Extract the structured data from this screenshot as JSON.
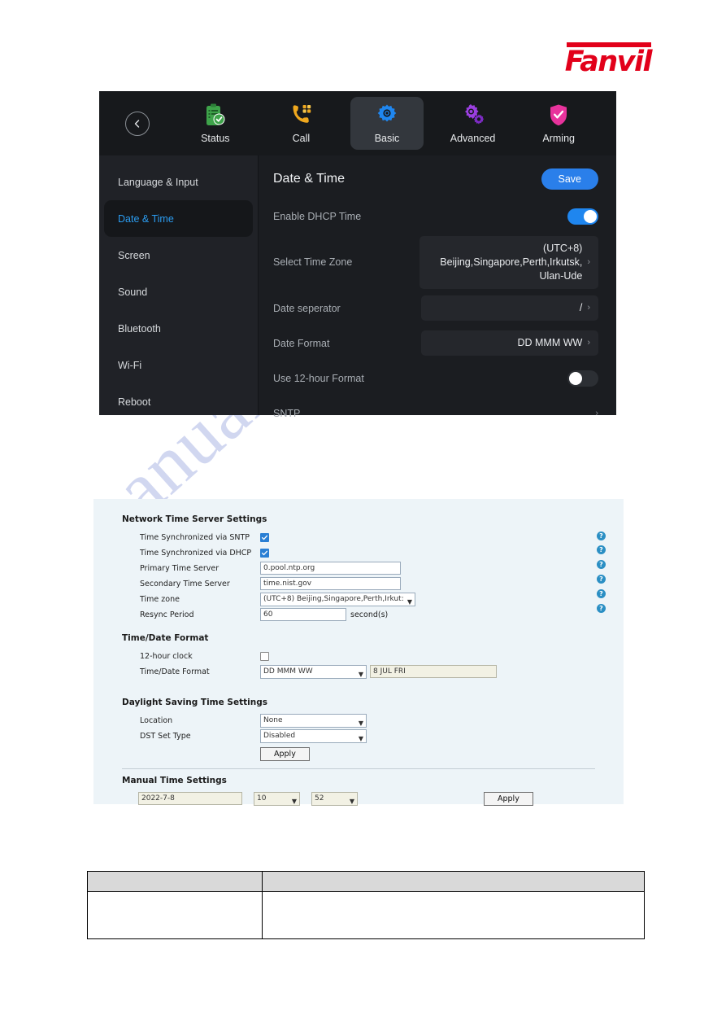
{
  "brand": {
    "name": "Fanvil",
    "color": "#e2001a"
  },
  "watermark": {
    "text": "manualshive.com"
  },
  "device": {
    "back_icon": "chevron-left-icon",
    "nav": [
      {
        "label": "Status",
        "icon": "clipboard-check-icon",
        "active": false
      },
      {
        "label": "Call",
        "icon": "phone-dialpad-icon",
        "active": false
      },
      {
        "label": "Basic",
        "icon": "gear-icon",
        "active": true
      },
      {
        "label": "Advanced",
        "icon": "double-gear-icon",
        "active": false
      },
      {
        "label": "Arming",
        "icon": "shield-check-icon",
        "active": false
      }
    ],
    "sidebar": [
      {
        "label": "Language & Input",
        "active": false
      },
      {
        "label": "Date & Time",
        "active": true
      },
      {
        "label": "Screen",
        "active": false
      },
      {
        "label": "Sound",
        "active": false
      },
      {
        "label": "Bluetooth",
        "active": false
      },
      {
        "label": "Wi-Fi",
        "active": false
      },
      {
        "label": "Reboot",
        "active": false
      }
    ],
    "panel": {
      "title": "Date & Time",
      "save_label": "Save",
      "rows": {
        "dhcp_time_label": "Enable DHCP Time",
        "dhcp_time_state": "on",
        "timezone_label": "Select Time Zone",
        "timezone_value": "(UTC+8) Beijing,Singapore,Perth,Irkutsk, Ulan-Ude",
        "separator_label": "Date seperator",
        "separator_value": "/",
        "dateformat_label": "Date Format",
        "dateformat_value": "DD MMM WW",
        "twelvehour_label": "Use 12-hour Format",
        "twelvehour_state": "off",
        "sntp_label": "SNTP"
      }
    }
  },
  "webpanel": {
    "sections": {
      "network": "Network Time Server Settings",
      "timedate": "Time/Date Format",
      "dst": "Daylight Saving Time Settings",
      "manual": "Manual Time Settings"
    },
    "labels": {
      "sntp": "Time Synchronized via SNTP",
      "dhcp": "Time Synchronized via DHCP",
      "primary": "Primary Time Server",
      "secondary": "Secondary Time Server",
      "timezone": "Time zone",
      "resync": "Resync Period",
      "clock12": "12-hour clock",
      "timedate_format": "Time/Date Format",
      "location": "Location",
      "dst_type": "DST Set Type"
    },
    "values": {
      "sntp_checked": "checked",
      "dhcp_checked": "checked",
      "primary": "0.pool.ntp.org",
      "secondary": "time.nist.gov",
      "timezone": "(UTC+8) Beijing,Singapore,Perth,Irkut:",
      "resync": "60",
      "resync_unit": "second(s)",
      "clock12_checked": "unchecked",
      "timedate_format": "DD MMM WW",
      "timedate_preview": "8 JUL FRI",
      "location": "None",
      "dst_type": "Disabled",
      "manual_date": "2022-7-8",
      "manual_hour": "10",
      "manual_minute": "52"
    },
    "buttons": {
      "apply": "Apply",
      "apply2": "Apply"
    },
    "help_icon": "?"
  }
}
